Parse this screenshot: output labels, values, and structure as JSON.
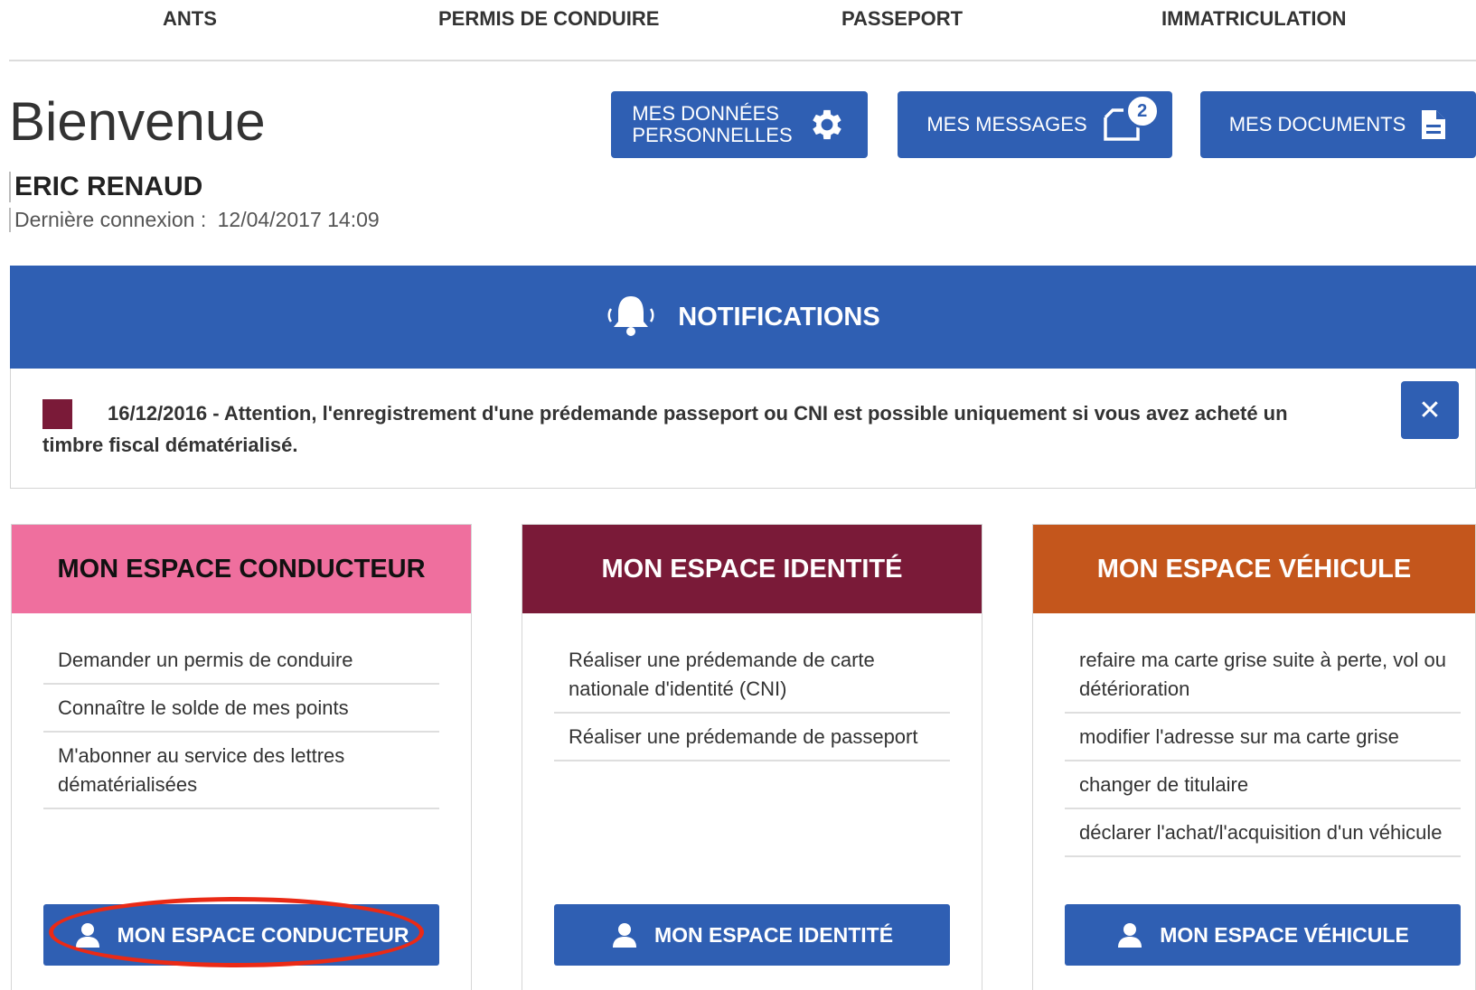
{
  "nav": [
    "ANTS",
    "PERMIS DE CONDUIRE",
    "PASSEPORT",
    "IMMATRICULATION"
  ],
  "welcome": "Bienvenue",
  "user": {
    "name": "ERIC RENAUD",
    "last_login_label": "Dernière connexion :",
    "last_login_value": "12/04/2017 14:09"
  },
  "header_buttons": {
    "personal_data_line1": "MES DONNÉES",
    "personal_data_line2": "PERSONNELLES",
    "messages": "MES MESSAGES",
    "messages_count": "2",
    "documents": "MES DOCUMENTS"
  },
  "notifications": {
    "title": "NOTIFICATIONS",
    "message": "16/12/2016 - Attention, l'enregistrement d'une prédemande passeport ou CNI est possible uniquement si vous avez acheté un timbre fiscal dématérialisé.",
    "close": "✕",
    "marker_color": "#7a1a38"
  },
  "spaces": {
    "conducteur": {
      "title": "MON ESPACE CONDUCTEUR",
      "color": "#ef6f9e",
      "items": [
        "Demander un permis de conduire",
        "Connaître le solde de mes points",
        "M'abonner au service des lettres dématérialisées"
      ],
      "button": "MON ESPACE CONDUCTEUR"
    },
    "identite": {
      "title": "MON ESPACE IDENTITÉ",
      "color": "#7a1a38",
      "items": [
        "Réaliser une prédemande de carte nationale d'identité (CNI)",
        "Réaliser une prédemande de passeport"
      ],
      "button": "MON ESPACE IDENTITÉ"
    },
    "vehicule": {
      "title": "MON ESPACE VÉHICULE",
      "color": "#c4561c",
      "items": [
        "refaire ma carte grise suite à perte, vol ou détérioration",
        "modifier l'adresse sur ma carte grise",
        "changer de titulaire",
        "déclarer l'achat/l'acquisition d'un véhicule"
      ],
      "button": "MON ESPACE VÉHICULE"
    }
  },
  "colors": {
    "primary": "#2f5fb3",
    "highlight": "#ea2a16"
  }
}
